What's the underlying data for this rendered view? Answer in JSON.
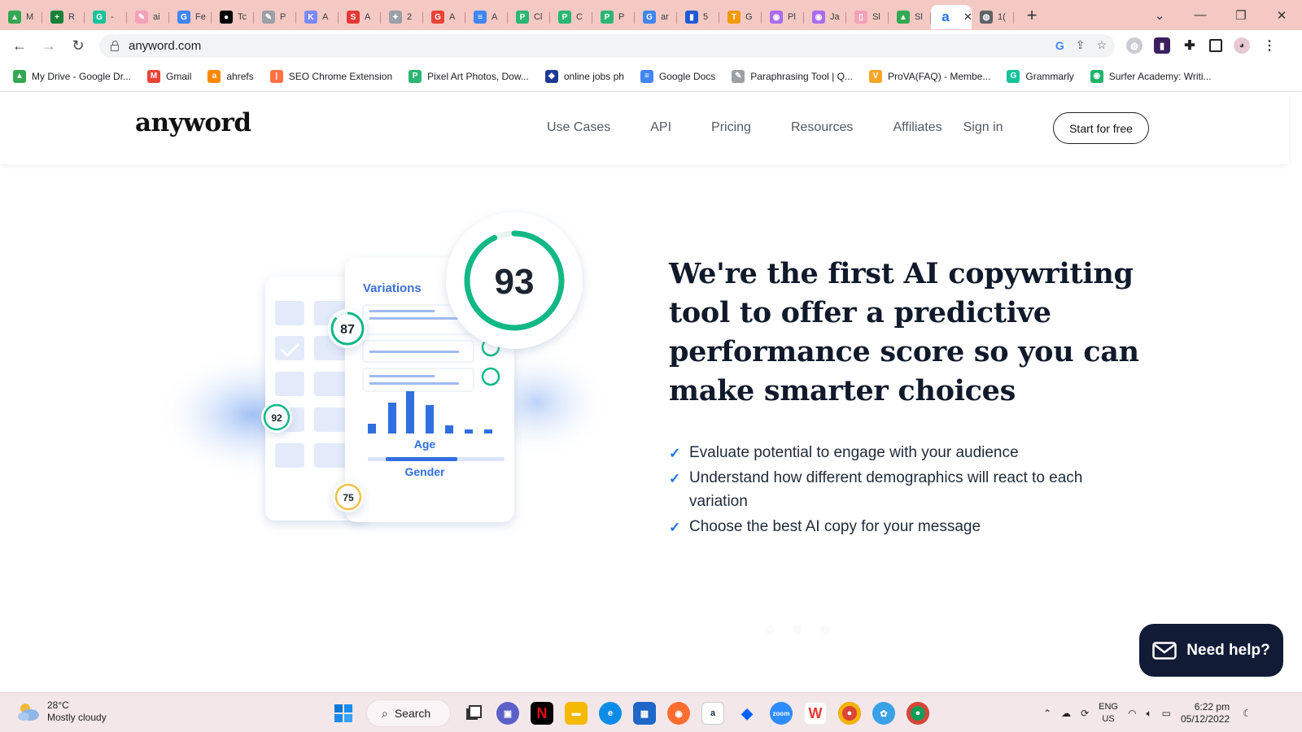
{
  "browser": {
    "tabs": [
      {
        "label": "M",
        "color": "#34a853",
        "glyph": "▲"
      },
      {
        "label": "R",
        "color": "#188038",
        "glyph": "+"
      },
      {
        "label": "-",
        "color": "#15c39a",
        "glyph": "G"
      },
      {
        "label": "ai",
        "color": "#f3a2b8",
        "glyph": "✎"
      },
      {
        "label": "Fe",
        "color": "#4285f4",
        "glyph": "G"
      },
      {
        "label": "Tc",
        "color": "#000000",
        "glyph": "●"
      },
      {
        "label": "P",
        "color": "#9aa0a6",
        "glyph": "✎"
      },
      {
        "label": "A",
        "color": "#7c88ff",
        "glyph": "K"
      },
      {
        "label": "A",
        "color": "#e53935",
        "glyph": "S"
      },
      {
        "label": "2",
        "color": "#9aa0a6",
        "glyph": "✦"
      },
      {
        "label": "A",
        "color": "#ea4335",
        "glyph": "G"
      },
      {
        "label": "A",
        "color": "#4285f4",
        "glyph": "≡"
      },
      {
        "label": "Cl",
        "color": "#2bb673",
        "glyph": "P"
      },
      {
        "label": "C",
        "color": "#2bb673",
        "glyph": "P"
      },
      {
        "label": "P",
        "color": "#2bb673",
        "glyph": "P"
      },
      {
        "label": "ar",
        "color": "#4285f4",
        "glyph": "G"
      },
      {
        "label": "5",
        "color": "#1e5bd6",
        "glyph": "▮"
      },
      {
        "label": "G",
        "color": "#f29900",
        "glyph": "T"
      },
      {
        "label": "Pl",
        "color": "#a96bf0",
        "glyph": "◉"
      },
      {
        "label": "Ja",
        "color": "#a96bf0",
        "glyph": "◉"
      },
      {
        "label": "Sl",
        "color": "#f3a2b8",
        "glyph": "▯"
      },
      {
        "label": "Sl",
        "color": "#34a853",
        "glyph": "▲"
      },
      {
        "label": "",
        "color": "#1a73e8",
        "glyph": "a",
        "active": true
      },
      {
        "label": "1(",
        "color": "#5f6368",
        "glyph": "◍"
      }
    ],
    "url": "anyword.com",
    "bookmarks": [
      {
        "label": "My Drive - Google Dr...",
        "color": "#34a853",
        "glyph": "▲"
      },
      {
        "label": "Gmail",
        "color": "#ea4335",
        "glyph": "M"
      },
      {
        "label": "ahrefs",
        "color": "#ff8800",
        "glyph": "a"
      },
      {
        "label": "SEO Chrome Extension",
        "color": "#ff7043",
        "glyph": "|"
      },
      {
        "label": "Pixel Art Photos, Dow...",
        "color": "#2bb673",
        "glyph": "P"
      },
      {
        "label": "online jobs ph",
        "color": "#1f3a93",
        "glyph": "◆"
      },
      {
        "label": "Google Docs",
        "color": "#4285f4",
        "glyph": "≡"
      },
      {
        "label": "Paraphrasing Tool | Q...",
        "color": "#9aa0a6",
        "glyph": "✎"
      },
      {
        "label": "ProVA(FAQ) - Membe...",
        "color": "#f5a623",
        "glyph": "V"
      },
      {
        "label": "Grammarly",
        "color": "#15c39a",
        "glyph": "G"
      },
      {
        "label": "Surfer Academy: Writi...",
        "color": "#20b26b",
        "glyph": "◉"
      }
    ]
  },
  "site": {
    "logo": "anyword",
    "nav": [
      "Use Cases",
      "API",
      "Pricing",
      "Resources",
      "Affiliates"
    ],
    "signin": "Sign in",
    "cta": "Start for free"
  },
  "hero": {
    "title": "We're the first AI copywriting tool to offer a predictive performance score so you can make smarter choices",
    "bullets": [
      "Evaluate potential to engage with your audience",
      "Understand how different demographics will react to each variation",
      "Choose the best AI copy for your message"
    ]
  },
  "illustration": {
    "main_score": "93",
    "main_score_fraction": 0.93,
    "scores": [
      "87",
      "92",
      "75"
    ],
    "card_title": "Variations",
    "age_label": "Age",
    "gender_label": "Gender",
    "score_color": "#12b886"
  },
  "help_widget": {
    "label": "Need help?"
  },
  "taskbar": {
    "weather_temp": "28°C",
    "weather_desc": "Mostly cloudy",
    "search": "Search",
    "lang1": "ENG",
    "lang2": "US",
    "time": "6:22 pm",
    "date": "05/12/2022"
  }
}
